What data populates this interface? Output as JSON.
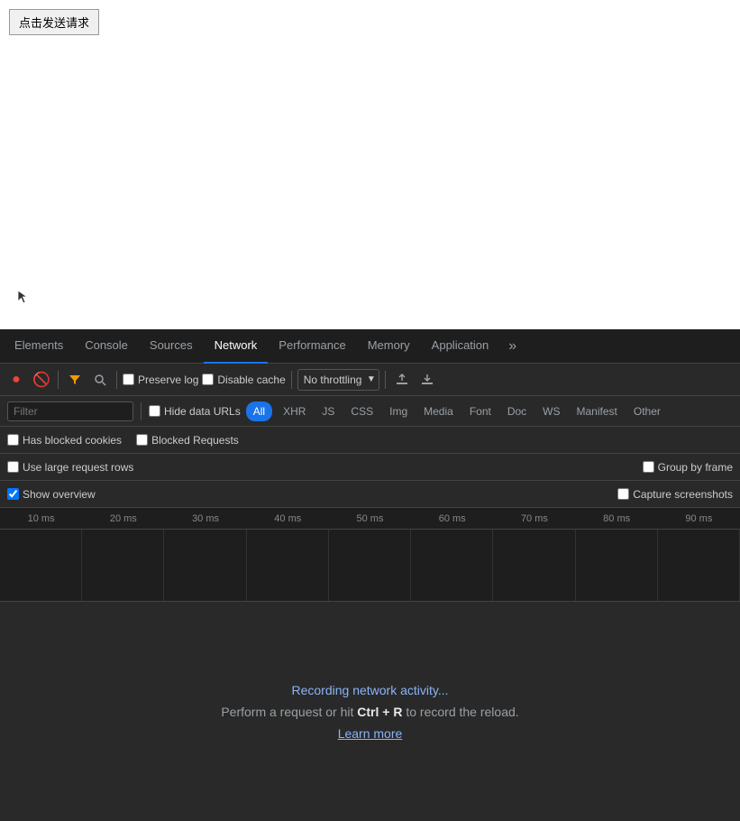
{
  "page": {
    "button_label": "点击发送请求"
  },
  "devtools": {
    "tabs": [
      {
        "id": "elements",
        "label": "Elements",
        "active": false
      },
      {
        "id": "console",
        "label": "Console",
        "active": false
      },
      {
        "id": "sources",
        "label": "Sources",
        "active": false
      },
      {
        "id": "network",
        "label": "Network",
        "active": true
      },
      {
        "id": "performance",
        "label": "Performance",
        "active": false
      },
      {
        "id": "memory",
        "label": "Memory",
        "active": false
      },
      {
        "id": "application",
        "label": "Application",
        "active": false
      }
    ],
    "toolbar": {
      "throttle_option": "No throttling",
      "preserve_log_label": "Preserve log",
      "disable_cache_label": "Disable cache"
    },
    "filter": {
      "placeholder": "Filter",
      "hide_data_urls_label": "Hide data URLs",
      "type_buttons": [
        {
          "id": "all",
          "label": "All",
          "active": true
        },
        {
          "id": "xhr",
          "label": "XHR",
          "active": false
        },
        {
          "id": "js",
          "label": "JS",
          "active": false
        },
        {
          "id": "css",
          "label": "CSS",
          "active": false
        },
        {
          "id": "img",
          "label": "Img",
          "active": false
        },
        {
          "id": "media",
          "label": "Media",
          "active": false
        },
        {
          "id": "font",
          "label": "Font",
          "active": false
        },
        {
          "id": "doc",
          "label": "Doc",
          "active": false
        },
        {
          "id": "ws",
          "label": "WS",
          "active": false
        },
        {
          "id": "manifest",
          "label": "Manifest",
          "active": false
        },
        {
          "id": "other",
          "label": "Other",
          "active": false
        }
      ]
    },
    "blocked_row": {
      "has_blocked_cookies_label": "Has blocked cookies",
      "blocked_requests_label": "Blocked Requests"
    },
    "options_row": {
      "use_large_rows_label": "Use large request rows",
      "group_by_frame_label": "Group by frame",
      "show_overview_label": "Show overview",
      "capture_screenshots_label": "Capture screenshots"
    },
    "timeline": {
      "labels": [
        "10 ms",
        "20 ms",
        "30 ms",
        "40 ms",
        "50 ms",
        "60 ms",
        "70 ms",
        "80 ms",
        "90 ms"
      ]
    },
    "empty_state": {
      "recording_text": "Recording network activity...",
      "instruction_text": "Perform a request or hit ",
      "shortcut": "Ctrl + R",
      "instruction_suffix": " to record the reload.",
      "learn_more_label": "Learn more"
    }
  }
}
